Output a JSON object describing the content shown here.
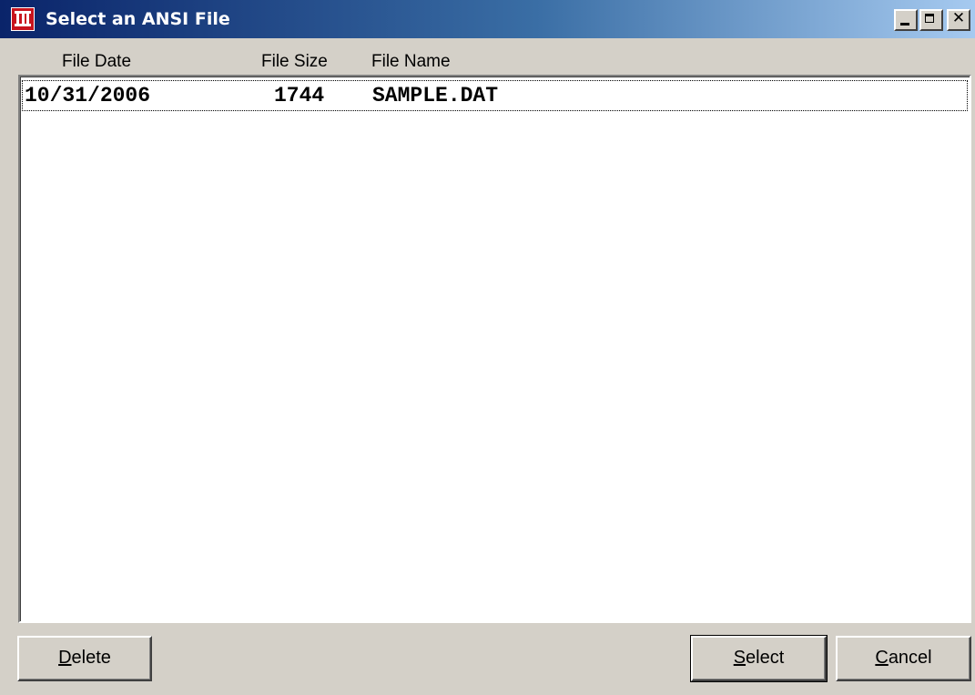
{
  "window": {
    "title": "Select an ANSI File",
    "controls": {
      "minimize_icon": "minimize-icon",
      "maximize_icon": "maximize-icon",
      "close_glyph": "✕"
    }
  },
  "columns": {
    "date": "File Date",
    "size": "File Size",
    "name": "File Name"
  },
  "files": [
    {
      "date": "10/31/2006",
      "size": "1744",
      "name": "SAMPLE.DAT"
    }
  ],
  "buttons": {
    "delete": {
      "accel": "D",
      "rest": "elete"
    },
    "select": {
      "accel": "S",
      "rest": "elect"
    },
    "cancel": {
      "accel": "C",
      "rest": "ancel"
    }
  },
  "colors": {
    "titlebar_start": "#0a246a",
    "titlebar_end": "#a6caf0",
    "app_icon": "#c8141e",
    "face": "#d4d0c8"
  }
}
